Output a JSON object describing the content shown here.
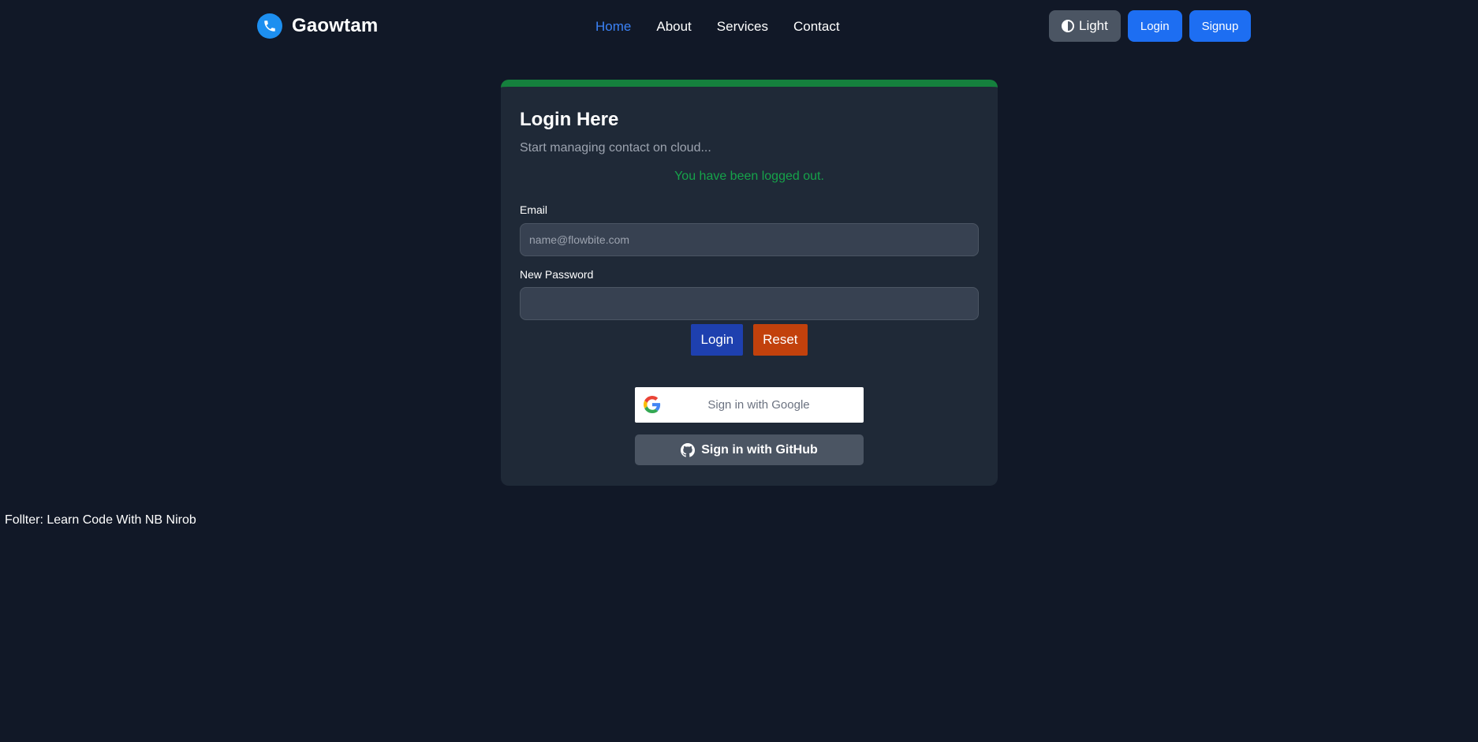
{
  "brand": {
    "name": "Gaowtam",
    "logo_icon": "phone-icon",
    "logo_color": "#1d8ff0"
  },
  "nav": {
    "links": [
      {
        "label": "Home",
        "active": true
      },
      {
        "label": "About",
        "active": false
      },
      {
        "label": "Services",
        "active": false
      },
      {
        "label": "Contact",
        "active": false
      }
    ],
    "active_color": "#3b82f6"
  },
  "header_actions": {
    "theme_toggle_label": "Light",
    "theme_icon": "contrast-icon",
    "login_label": "Login",
    "signup_label": "Signup"
  },
  "login_card": {
    "title": "Login Here",
    "subtitle": "Start managing contact on cloud...",
    "status_message": "You have been logged out.",
    "status_color": "#16a34a",
    "accent_color": "#15803d",
    "email": {
      "label": "Email",
      "placeholder": "name@flowbite.com",
      "value": ""
    },
    "password": {
      "label": "New Password",
      "value": ""
    },
    "submit_label": "Login",
    "reset_label": "Reset",
    "google_label": "Sign in with Google",
    "github_label": "Sign in with GitHub"
  },
  "footer": {
    "text": "Follter: Learn Code With NB Nirob"
  },
  "colors": {
    "background": "#111827",
    "card": "#1f2937",
    "primary_button": "#1d6ef2",
    "reset_button": "#c2410c"
  }
}
